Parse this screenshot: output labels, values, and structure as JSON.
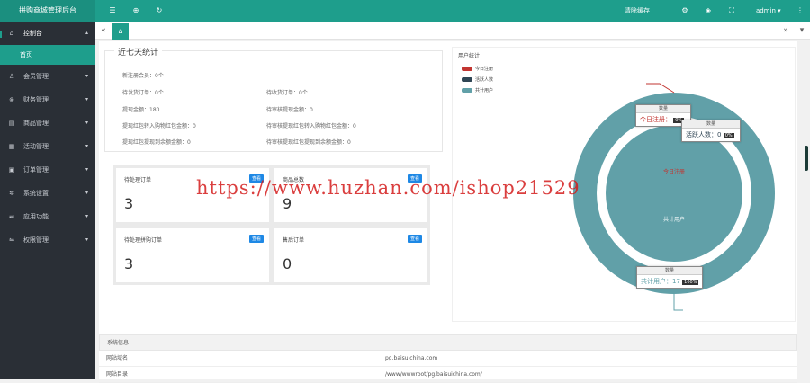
{
  "brand": {
    "title": "拼购商城管理后台"
  },
  "topbar": {
    "icons": {
      "menu": "☰",
      "globe": "⊕",
      "refresh": "↻",
      "settings": "⚙",
      "skin": "◈",
      "fullscreen": "⛶",
      "more": "⋮"
    },
    "clear_cache": "清除缓存",
    "username": "admin",
    "caret": "▾"
  },
  "sidebar": {
    "console": {
      "label": "控制台",
      "icon": "⌂",
      "arrow": "▴"
    },
    "console_sub": "首页",
    "items": [
      {
        "label": "会员管理",
        "icon": "♙",
        "arrow": "▾"
      },
      {
        "label": "财务管理",
        "icon": "⊗",
        "arrow": "▾"
      },
      {
        "label": "商品管理",
        "icon": "▤",
        "arrow": "▾"
      },
      {
        "label": "活动管理",
        "icon": "▦",
        "arrow": "▾"
      },
      {
        "label": "订单管理",
        "icon": "▣",
        "arrow": "▾"
      },
      {
        "label": "系统设置",
        "icon": "✲",
        "arrow": "▾"
      },
      {
        "label": "应用功能",
        "icon": "⇌",
        "arrow": "▾"
      },
      {
        "label": "权限管理",
        "icon": "⇋",
        "arrow": "▾"
      }
    ]
  },
  "tabbar": {
    "left": "«",
    "right": "»",
    "home": "⌂",
    "caret": "▾"
  },
  "stats": {
    "title": "近七天统计",
    "new_members": "新注册会员：0个",
    "pending_orders": "待发货订单：0个",
    "pending_receive": "待收货订单：0个",
    "withdraw_amount": "提现金额：180",
    "pending_withdraw": "待审核提现金额：0",
    "cash_purchase": "提现红包转入购物红包金额：0",
    "pending_cash_purchase": "待审核提现红包转入购物红包金额：0",
    "cash_balance": "提现红包提现到余额金额：0",
    "pending_cash_balance": "待审核提现红包提现到余额金额：0"
  },
  "cards": [
    {
      "title": "待处理订单",
      "badge": "查看",
      "value": "3"
    },
    {
      "title": "商品总数",
      "badge": "查看",
      "value": "9"
    },
    {
      "title": "待处理拼购订单",
      "badge": "查看",
      "value": "3"
    },
    {
      "title": "售后订单",
      "badge": "查看",
      "value": "0"
    }
  ],
  "user_chart": {
    "title": "用户统计",
    "legend": [
      {
        "label": "今日注册",
        "color": "#c23531"
      },
      {
        "label": "活跃人数",
        "color": "#2f4554"
      },
      {
        "label": "共计用户",
        "color": "#61a0a8"
      }
    ],
    "outer_ring_color": "#61a0a8",
    "inner_pie_color": "#61a0a8",
    "inner_label": "共计用户",
    "overlap_label": "今日注册",
    "tooltip_today": {
      "header": "数量",
      "text": "今日注册：",
      "pct": "0%"
    },
    "tooltip_active": {
      "header": "数量",
      "text": "活跃人数：0",
      "pct": "0%"
    },
    "tooltip_total": {
      "header": "数量",
      "text": "共计用户：17",
      "pct": "100%"
    }
  },
  "chart_data": {
    "type": "pie",
    "title": "用户统计",
    "categories": [
      "今日注册",
      "活跃人数",
      "共计用户"
    ],
    "series": [
      {
        "name": "数量",
        "values": [
          0,
          0,
          17
        ]
      }
    ]
  },
  "sysinfo": {
    "title": "系统信息",
    "rows": [
      {
        "key": "网站域名",
        "value": "pg.baisuichina.com"
      },
      {
        "key": "网站目录",
        "value": "/www/wwwroot/pg.baisuichina.com/"
      }
    ]
  },
  "watermark": "https://www.huzhan.com/ishop21529"
}
